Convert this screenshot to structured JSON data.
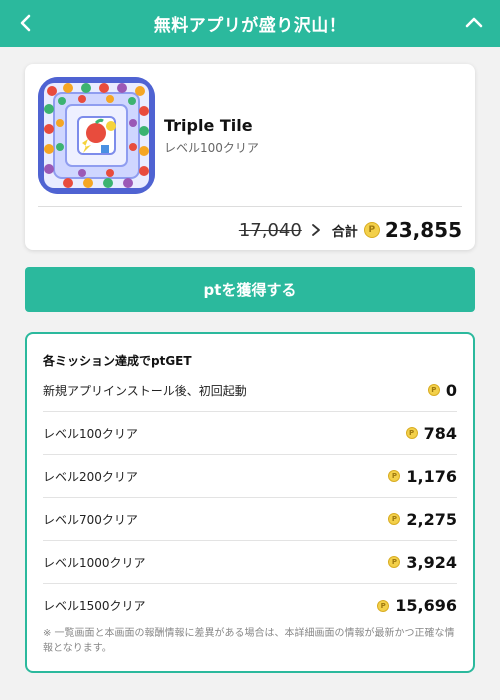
{
  "header": {
    "title": "無料アプリが盛り沢山！",
    "back_icon": "chevron-left-icon",
    "collapse_icon": "chevron-up-icon",
    "bg_color": "#2bb99d"
  },
  "app": {
    "name": "Triple Tile",
    "subtitle": "レベル100クリア",
    "icon": "tile-puzzle-app-icon",
    "old_points": "17,040",
    "total_label": "合計",
    "coin_symbol": "P",
    "total_points": "23,855"
  },
  "cta": {
    "label": "ptを獲得する"
  },
  "missions": {
    "heading": "各ミッション達成でptGET",
    "items": [
      {
        "label": "新規アプリインストール後、初回起動",
        "points": "0"
      },
      {
        "label": "レベル100クリア",
        "points": "784"
      },
      {
        "label": "レベル200クリア",
        "points": "1,176"
      },
      {
        "label": "レベル700クリア",
        "points": "2,275"
      },
      {
        "label": "レベル1000クリア",
        "points": "3,924"
      },
      {
        "label": "レベル1500クリア",
        "points": "15,696"
      }
    ],
    "note": "※ 一覧画面と本画面の報酬情報に差異がある場合は、本詳細画面の情報が最新かつ正確な情報となります。"
  }
}
